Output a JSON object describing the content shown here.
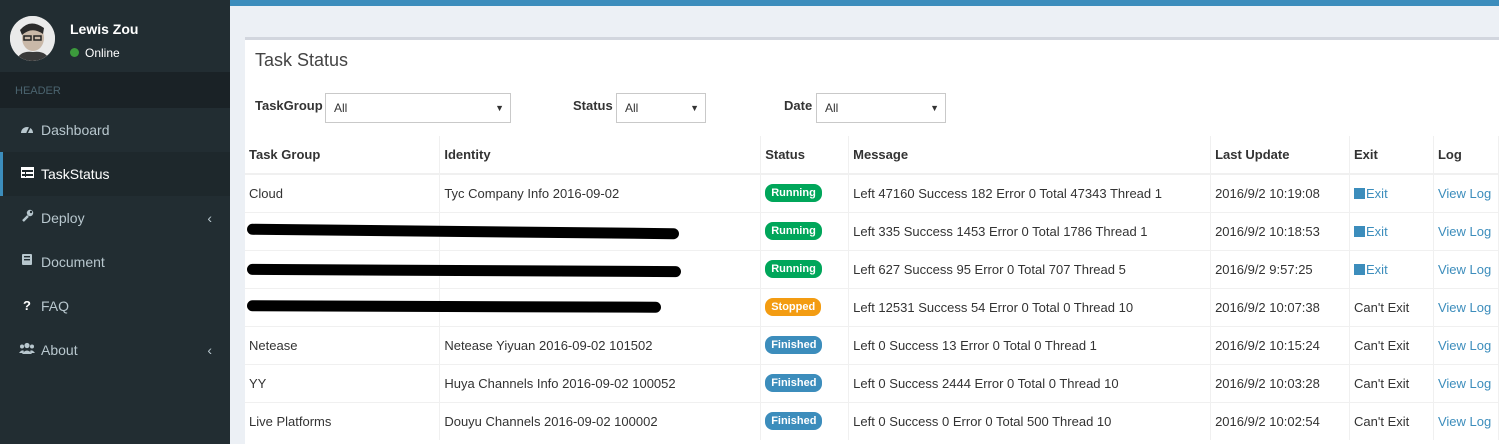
{
  "user": {
    "name": "Lewis Zou",
    "status": "Online"
  },
  "sidebar": {
    "header": "HEADER",
    "items": [
      {
        "label": "Dashboard",
        "icon": "dashboard-icon"
      },
      {
        "label": "TaskStatus",
        "icon": "table-icon"
      },
      {
        "label": "Deploy",
        "icon": "wrench-icon"
      },
      {
        "label": "Document",
        "icon": "book-icon"
      },
      {
        "label": "FAQ",
        "icon": "question-icon"
      },
      {
        "label": "About",
        "icon": "users-icon"
      }
    ]
  },
  "box": {
    "title": "Task Status"
  },
  "filters": {
    "taskgroup": {
      "label": "TaskGroup",
      "value": "All"
    },
    "status": {
      "label": "Status",
      "value": "All"
    },
    "date": {
      "label": "Date",
      "value": "All"
    }
  },
  "table": {
    "headers": [
      "Task Group",
      "Identity",
      "Status",
      "Message",
      "Last Update",
      "Exit",
      "Log"
    ],
    "rows": [
      {
        "group": "Cloud",
        "identity": "Tyc Company Info 2016-09-02",
        "status": "Running",
        "message": "Left 47160 Success 182 Error 0 Total 47343 Thread 1",
        "updated": "2016/9/2 10:19:08",
        "exit": "Exit",
        "log": "View Log"
      },
      {
        "group": "",
        "identity": "",
        "status": "Running",
        "message": "Left 335 Success 1453 Error 0 Total 1786 Thread 1",
        "updated": "2016/9/2 10:18:53",
        "exit": "Exit",
        "log": "View Log"
      },
      {
        "group": "",
        "identity": "",
        "status": "Running",
        "message": "Left 627 Success 95 Error 0 Total 707 Thread 5",
        "updated": "2016/9/2 9:57:25",
        "exit": "Exit",
        "log": "View Log"
      },
      {
        "group": "",
        "identity": "",
        "status": "Stopped",
        "message": "Left 12531 Success 54 Error 0 Total 0 Thread 10",
        "updated": "2016/9/2 10:07:38",
        "exit": "Can't Exit",
        "log": "View Log"
      },
      {
        "group": "Netease",
        "identity": "Netease Yiyuan 2016-09-02 101502",
        "status": "Finished",
        "message": "Left 0 Success 13 Error 0 Total 0 Thread 1",
        "updated": "2016/9/2 10:15:24",
        "exit": "Can't Exit",
        "log": "View Log"
      },
      {
        "group": "YY",
        "identity": "Huya Channels Info 2016-09-02 100052",
        "status": "Finished",
        "message": "Left 0 Success 2444 Error 0 Total 0 Thread 10",
        "updated": "2016/9/2 10:03:28",
        "exit": "Can't Exit",
        "log": "View Log"
      },
      {
        "group": "Live Platforms",
        "identity": "Douyu Channels 2016-09-02 100002",
        "status": "Finished",
        "message": "Left 0 Success 0 Error 0 Total 500 Thread 10",
        "updated": "2016/9/2 10:02:54",
        "exit": "Can't Exit",
        "log": "View Log"
      }
    ]
  },
  "colors": {
    "accent": "#3c8dbc",
    "sidebar": "#222d32",
    "running": "#00a65a",
    "stopped": "#f39c12",
    "finished": "#3c8dbc"
  }
}
